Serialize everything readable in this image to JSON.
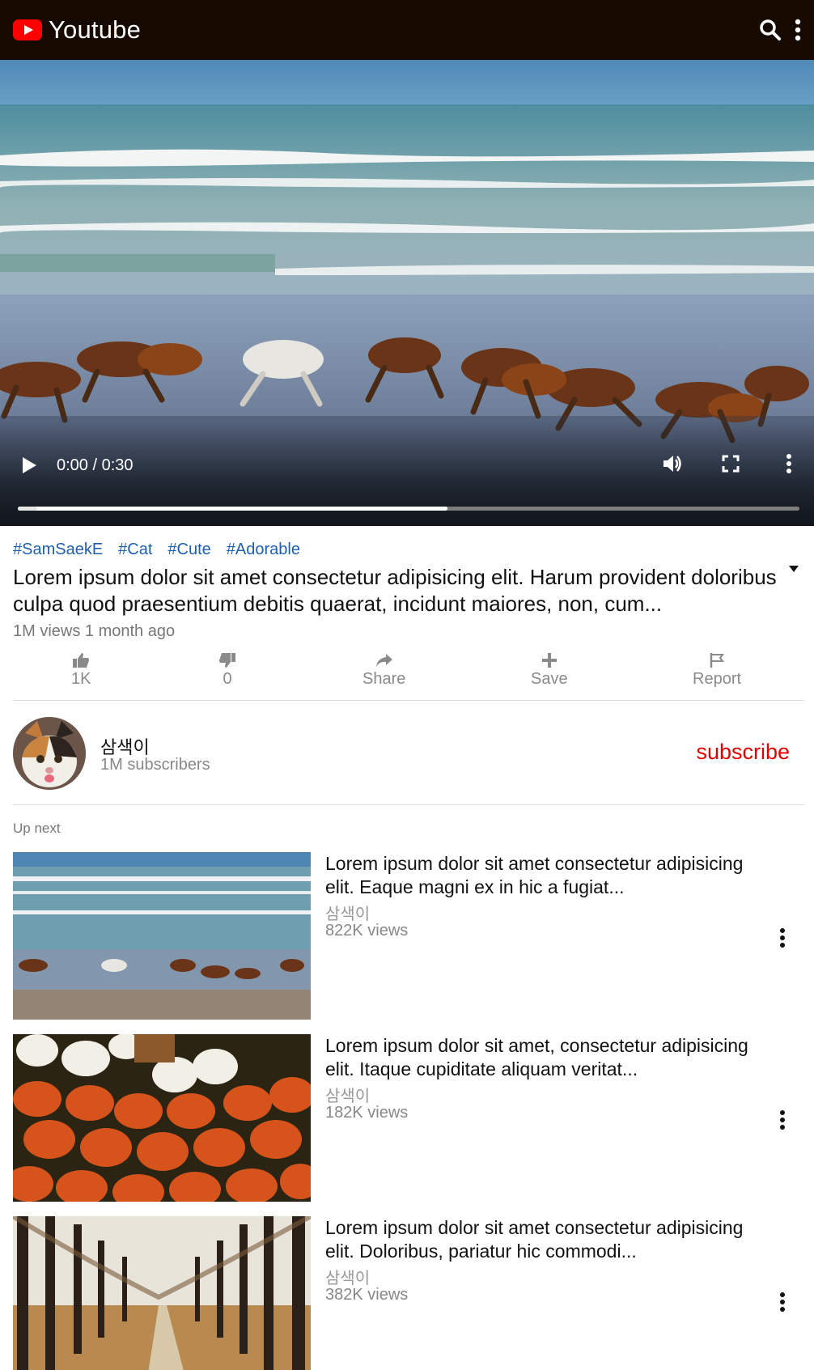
{
  "header": {
    "logo_text": "Youtube",
    "icons": [
      "youtube-logo-icon",
      "search-icon",
      "more-vertical-icon"
    ],
    "background": "#150900",
    "accent": "#ff0000"
  },
  "player": {
    "time": "0:00 / 0:30",
    "progress_fraction": 0.0,
    "buffered_fraction": 0.55,
    "icons": [
      "play-icon",
      "volume-icon",
      "fullscreen-icon",
      "more-vertical-icon"
    ]
  },
  "video": {
    "tags": [
      "#SamSaekE",
      "#Cat",
      "#Cute",
      "#Adorable"
    ],
    "title": "Lorem ipsum dolor sit amet consectetur adipisicing elit. Harum provident doloribus culpa quod praesentium debitis quaerat, incidunt maiores, non, cum...",
    "meta": "1M views 1 month ago",
    "actions": {
      "like": "1K",
      "dislike": "0",
      "share": "Share",
      "save": "Save",
      "report": "Report"
    }
  },
  "channel": {
    "name": "삼색이",
    "subscribers": "1M subscribers",
    "subscribe_label": "subscribe"
  },
  "up_next": {
    "label": "Up next",
    "items": [
      {
        "title": "Lorem ipsum dolor sit amet consectetur adipisicing elit. Eaque magni ex in hic a fugiat...",
        "channel": "삼색이",
        "views": "822K views",
        "thumbnail": "horses-on-beach"
      },
      {
        "title": "Lorem ipsum dolor sit amet, consectetur adipisicing elit. Itaque cupiditate aliquam veritat...",
        "channel": "삼색이",
        "views": "182K views",
        "thumbnail": "pumpkins"
      },
      {
        "title": "Lorem ipsum dolor sit amet consectetur adipisicing elit. Doloribus, pariatur hic commodi...",
        "channel": "삼색이",
        "views": "382K views",
        "thumbnail": "autumn-tree-path"
      }
    ]
  }
}
